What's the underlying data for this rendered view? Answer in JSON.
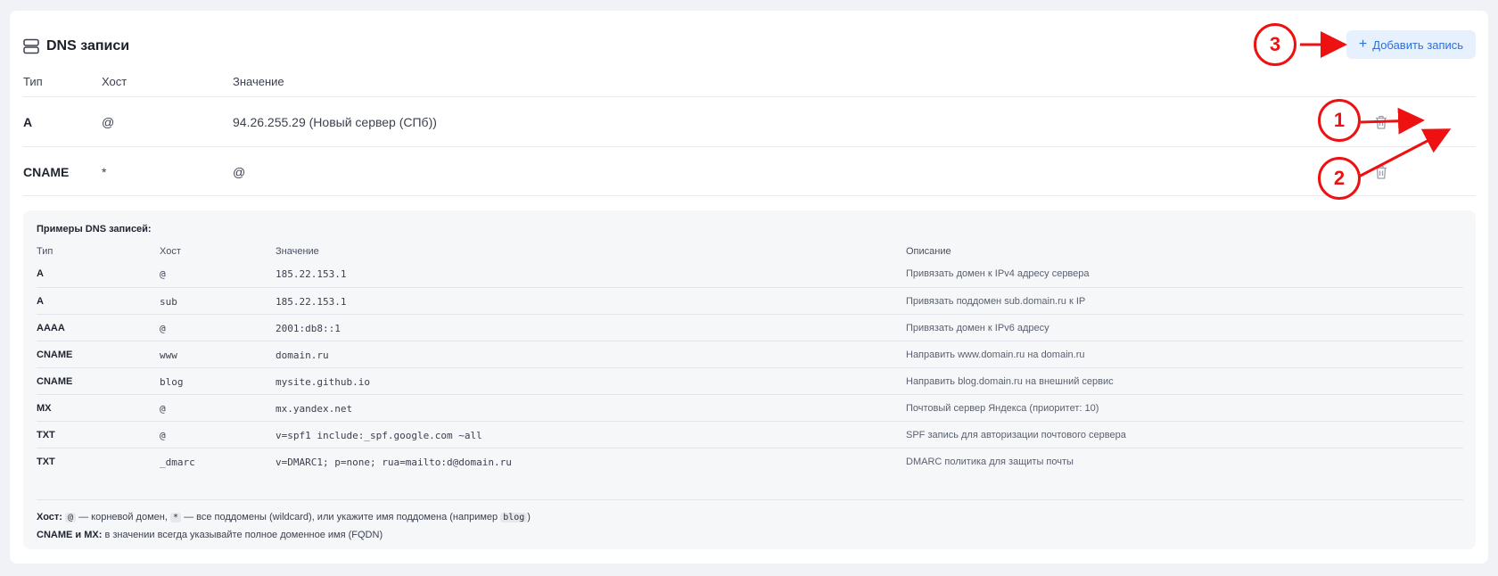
{
  "header": {
    "title": "DNS записи",
    "add_button_label": "Добавить запись"
  },
  "columns": {
    "type": "Тип",
    "host": "Хост",
    "value": "Значение"
  },
  "records": [
    {
      "type": "A",
      "host": "@",
      "value": "94.26.255.29 (Новый сервер (СПб))"
    },
    {
      "type": "CNAME",
      "host": "*",
      "value": "@"
    }
  ],
  "examples": {
    "title": "Примеры DNS записей:",
    "columns": {
      "type": "Тип",
      "host": "Хост",
      "value": "Значение",
      "desc": "Описание"
    },
    "rows": [
      {
        "type": "A",
        "host": "@",
        "value": "185.22.153.1",
        "desc": "Привязать домен к IPv4 адресу сервера"
      },
      {
        "type": "A",
        "host": "sub",
        "value": "185.22.153.1",
        "desc": "Привязать поддомен sub.domain.ru к IP"
      },
      {
        "type": "AAAA",
        "host": "@",
        "value": "2001:db8::1",
        "desc": "Привязать домен к IPv6 адресу"
      },
      {
        "type": "CNAME",
        "host": "www",
        "value": "domain.ru",
        "desc": "Направить www.domain.ru на domain.ru"
      },
      {
        "type": "CNAME",
        "host": "blog",
        "value": "mysite.github.io",
        "desc": "Направить blog.domain.ru на внешний сервис"
      },
      {
        "type": "MX",
        "host": "@",
        "value": "mx.yandex.net",
        "desc": "Почтовый сервер Яндекса (приоритет: 10)"
      },
      {
        "type": "TXT",
        "host": "@",
        "value": "v=spf1 include:_spf.google.com ~all",
        "desc": "SPF запись для авторизации почтового сервера"
      },
      {
        "type": "TXT",
        "host": "_dmarc",
        "value": "v=DMARC1; p=none; rua=mailto:d@domain.ru",
        "desc": "DMARC политика для защиты почты"
      }
    ],
    "note1": {
      "label": "Хост:",
      "code_root": "@",
      "text_root": "— корневой домен,",
      "code_wild": "*",
      "text_wild": "— все поддомены (wildcard), или укажите имя поддомена (например",
      "code_example": "blog",
      "text_close": ")"
    },
    "note2": {
      "label": "CNAME и MX:",
      "text": "в значении всегда указывайте полное доменное имя (FQDN)"
    }
  },
  "annotations": [
    "1",
    "2",
    "3"
  ],
  "colors": {
    "accent": "#2f6fd8",
    "accent_bg": "#e7f0fd",
    "annotation": "#ee1111"
  },
  "icons": {
    "section": "server-icon",
    "edit": "pencil-icon",
    "delete": "trash-icon",
    "add": "plus-icon"
  }
}
